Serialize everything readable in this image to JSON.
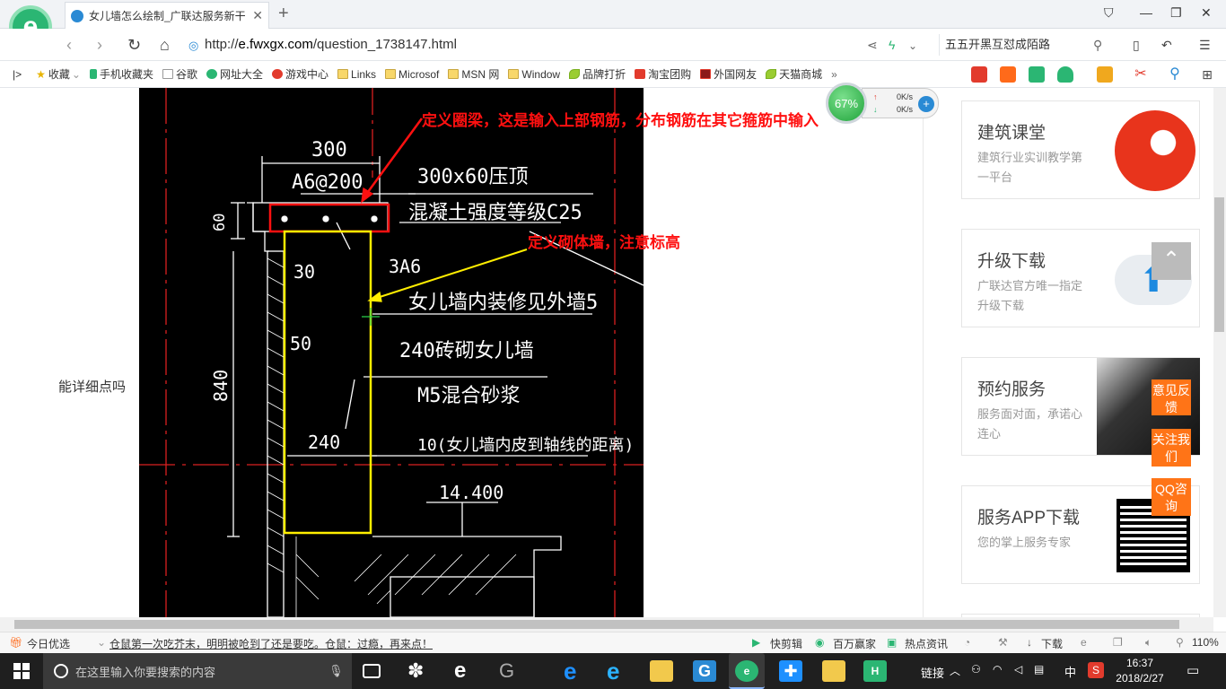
{
  "browser": {
    "tab_title": "女儿墙怎么绘制_广联达服务新干",
    "url_prefix": "http://",
    "url_host": "e.fwxgx.com",
    "url_path": "/question_1738147.html",
    "search_text": "五五开黑互怼成陌路"
  },
  "bookmarks": [
    {
      "label": "收藏",
      "icon": "star-icon"
    },
    {
      "label": "手机收藏夹",
      "icon": "phone-icon"
    },
    {
      "label": "谷歌",
      "icon": "page-icon"
    },
    {
      "label": "网址大全",
      "icon": "green-globe-icon"
    },
    {
      "label": "游戏中心",
      "icon": "game-icon"
    },
    {
      "label": "Links",
      "icon": "folder-icon"
    },
    {
      "label": "Microsof",
      "icon": "folder-icon"
    },
    {
      "label": "MSN 网",
      "icon": "folder-icon"
    },
    {
      "label": "Window",
      "icon": "folder-icon"
    },
    {
      "label": "品牌打折",
      "icon": "leaf-icon"
    },
    {
      "label": "淘宝团购",
      "icon": "taobao-icon"
    },
    {
      "label": "外国网友",
      "icon": "flag-icon"
    },
    {
      "label": "天猫商城",
      "icon": "leaf-icon"
    }
  ],
  "page": {
    "question_text": "能详细点吗",
    "annotations": {
      "beam": "定义圈梁，这是输入上部钢筋，分布钢筋在其它箍筋中输入",
      "wall": "定义砌体墙，注意标高"
    },
    "cad": {
      "dim_300": "300",
      "rebar_top": "A6@200",
      "cap": "300x60压顶",
      "concrete": "混凝土强度等级C25",
      "dim_60": "60",
      "dim_30": "30",
      "rebar_3a6": "3A6",
      "finish": "女儿墙内装修见外墙5",
      "dim_50": "50",
      "wall": "240砖砌女儿墙",
      "mortar": "M5混合砂浆",
      "dim_840": "840",
      "dim_240": "240",
      "distance": "10(女儿墙内皮到轴线的距离)",
      "elevation": "14.400"
    }
  },
  "sidebar_cards": [
    {
      "title": "建筑课堂",
      "desc": "建筑行业实训教学第一平台"
    },
    {
      "title": "升级下载",
      "desc": "广联达官方唯一指定升级下载"
    },
    {
      "title": "预约服务",
      "desc": "服务面对面，承诺心连心"
    },
    {
      "title": "服务APP下载",
      "desc": "您的掌上服务专家"
    }
  ],
  "float_buttons": {
    "feedback": "意见反馈",
    "follow": "关注我们",
    "qq": "QQ咨询"
  },
  "net_widget": {
    "percent": "67%",
    "up": "0K/s",
    "down": "0K/s"
  },
  "statusbar": {
    "today": "今日优选",
    "news": "仓鼠第一次吃芥末，明明被呛到了还是要吃。仓鼠：过瘾，再来点！",
    "quickcut": "快剪辑",
    "million": "百万赢家",
    "hotnews": "热点资讯",
    "download": "下载",
    "zoom": "110%"
  },
  "taskbar": {
    "search_placeholder": "在这里输入你要搜索的内容",
    "link": "链接",
    "ime": "中",
    "time": "16:37",
    "date": "2018/2/27"
  }
}
